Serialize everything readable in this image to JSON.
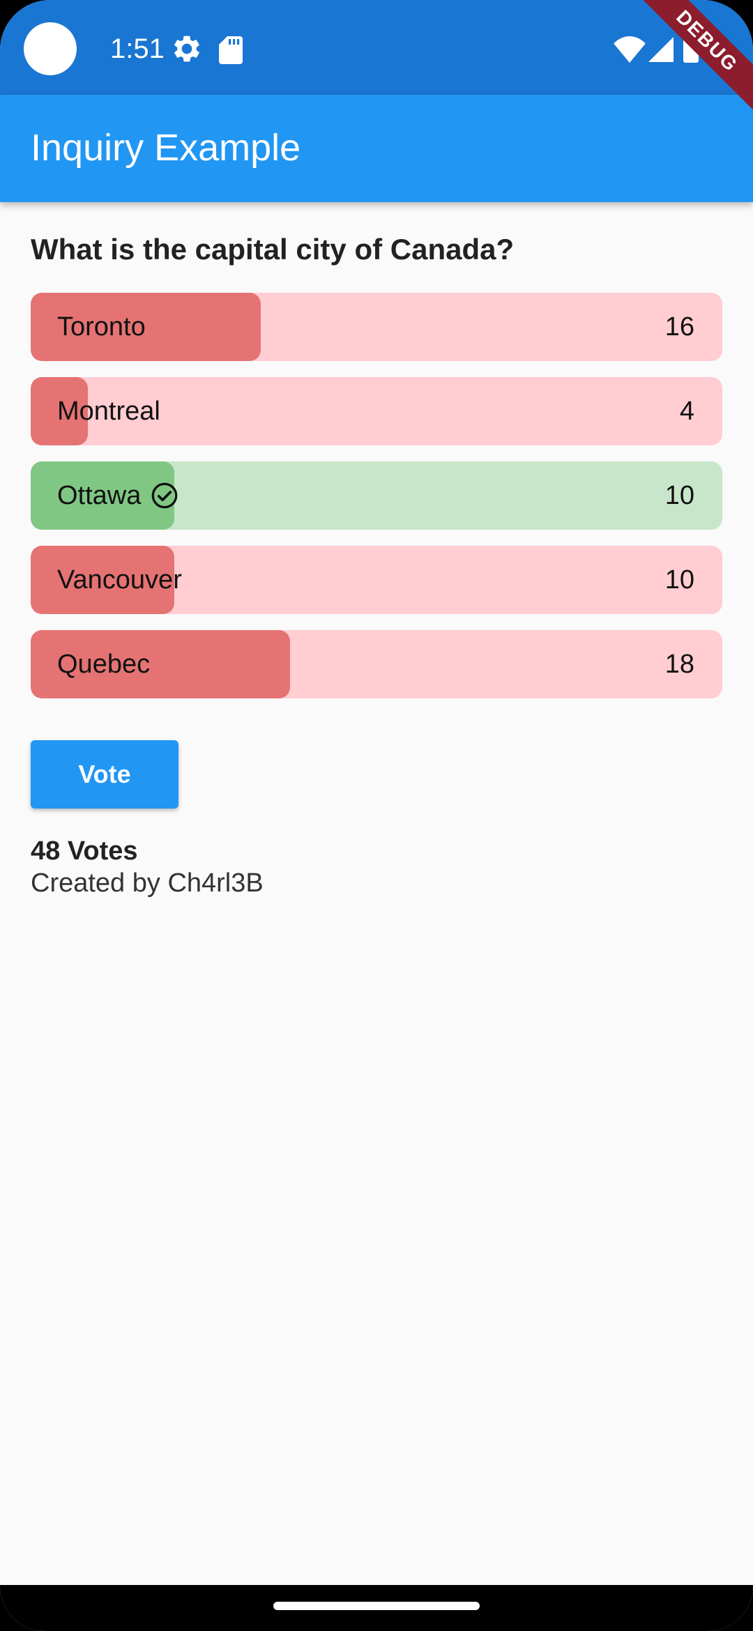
{
  "status_bar": {
    "time": "1:51",
    "debug_label": "DEBUG",
    "icons": [
      "camera-cutout",
      "gear-icon",
      "sd-card-icon",
      "wifi-icon",
      "signal-icon",
      "battery-icon"
    ]
  },
  "app_bar": {
    "title": "Inquiry Example"
  },
  "poll": {
    "question": "What is the capital city of Canada?",
    "options": [
      {
        "label": "Toronto",
        "count": "16",
        "fill_fraction": 0.333,
        "correct": false
      },
      {
        "label": "Montreal",
        "count": "4",
        "fill_fraction": 0.083,
        "correct": false
      },
      {
        "label": "Ottawa",
        "count": "10",
        "fill_fraction": 0.208,
        "correct": true
      },
      {
        "label": "Vancouver",
        "count": "10",
        "fill_fraction": 0.208,
        "correct": false
      },
      {
        "label": "Quebec",
        "count": "18",
        "fill_fraction": 0.375,
        "correct": false
      }
    ],
    "vote_button": "Vote",
    "total_votes": "48 Votes",
    "creator": "Created by Ch4rl3B"
  },
  "colors": {
    "status_bar": "#1976d2",
    "app_bar": "#2196f3",
    "wrong_fill": "#e57373",
    "wrong_track": "#ffcdd2",
    "correct_fill": "#81c784",
    "correct_track": "#c8e6c9"
  }
}
